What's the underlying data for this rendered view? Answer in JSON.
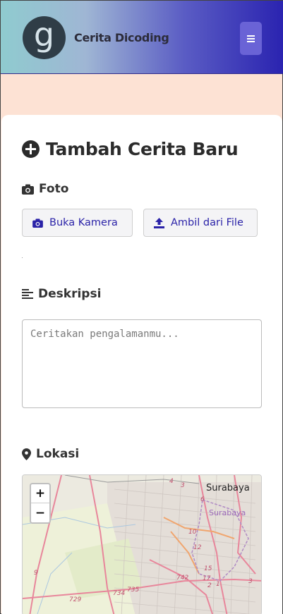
{
  "header": {
    "logo_letter": "g",
    "brand": "Cerita Dicoding",
    "menu_icon": "bars-icon"
  },
  "form": {
    "title": "Tambah Cerita Baru",
    "title_icon": "plus-circle-icon",
    "photo": {
      "label": "Foto",
      "icon": "camera-icon",
      "camera_button": "Buka Kamera",
      "file_button": "Ambil dari File"
    },
    "description": {
      "label": "Deskripsi",
      "icon": "align-left-icon",
      "placeholder": "Ceritakan pengalamanmu..."
    },
    "location": {
      "label": "Lokasi",
      "icon": "map-pin-icon"
    }
  },
  "map": {
    "zoom_in": "+",
    "zoom_out": "−",
    "city_label": "Surabaya",
    "city_label_small": "Surabaya",
    "road_numbers": [
      "4",
      "3",
      "6",
      "10",
      "12",
      "15",
      "17",
      "742",
      "9",
      "734",
      "735",
      "729",
      "2",
      "3",
      "1"
    ]
  },
  "colors": {
    "header_gradient_start": "#8fcbcf",
    "header_gradient_end": "#2a23b0",
    "accent": "#2a22a8",
    "page_background": "#fde2d4"
  }
}
